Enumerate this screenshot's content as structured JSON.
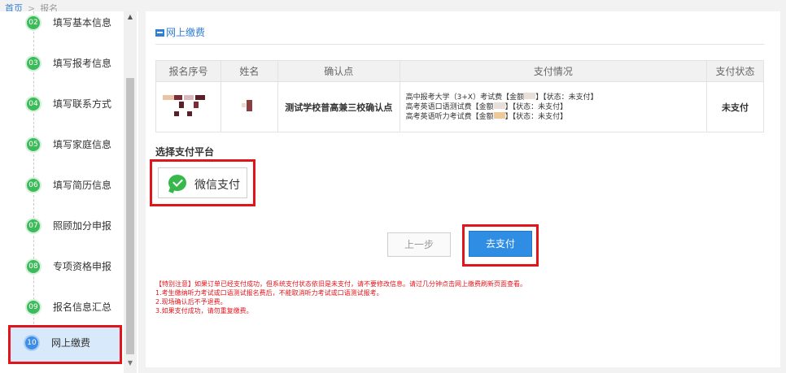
{
  "breadcrumb": {
    "home": "首页",
    "separator": ">",
    "current": "报名"
  },
  "sidebar": {
    "steps": [
      {
        "num": "02",
        "label": "填写基本信息"
      },
      {
        "num": "03",
        "label": "填写报考信息"
      },
      {
        "num": "04",
        "label": "填写联系方式"
      },
      {
        "num": "05",
        "label": "填写家庭信息"
      },
      {
        "num": "06",
        "label": "填写简历信息"
      },
      {
        "num": "07",
        "label": "照顾加分申报"
      },
      {
        "num": "08",
        "label": "专项资格申报"
      },
      {
        "num": "09",
        "label": "报名信息汇总"
      },
      {
        "num": "10",
        "label": "网上缴费"
      }
    ],
    "scroll_up": "▲",
    "scroll_down": "▼"
  },
  "main": {
    "section_title": "网上缴费",
    "table": {
      "headers": [
        "报名序号",
        "姓名",
        "确认点",
        "支付情况",
        "支付状态"
      ],
      "row": {
        "confirm_point": "测试学校普高兼三校确认点",
        "payment_lines": [
          {
            "prefix": "高中报考大学（3+X）考试费【金额",
            "suffix": "】【状态：未支付】"
          },
          {
            "prefix": "高考英语口语测试费【金额",
            "suffix": "】【状态：未支付】"
          },
          {
            "prefix": "高考英语听力考试费【金额",
            "suffix": "】【状态：未支付】"
          }
        ],
        "status": "未支付"
      }
    },
    "platform_title": "选择支付平台",
    "wechat_label": "微信支付",
    "prev_label": "上一步",
    "pay_label": "去支付",
    "notes": [
      "【特别注意】如果订单已经支付成功，但系统支付状态依旧是未支付，请不要修改信息。请过几分钟点击网上缴费刷新页面查看。",
      "1.考生缴纳听力考试或口语测试报名费后，不能取消听力考试或口语测试报考。",
      "2.现场确认后不予退费。",
      "3.如果支付成功，请勿重复缴费。"
    ]
  },
  "colors": {
    "accent": "#2f7fd6",
    "step_green": "#3dbb5a",
    "highlight_red": "#e0141b",
    "wechat_green": "#36b84a"
  }
}
